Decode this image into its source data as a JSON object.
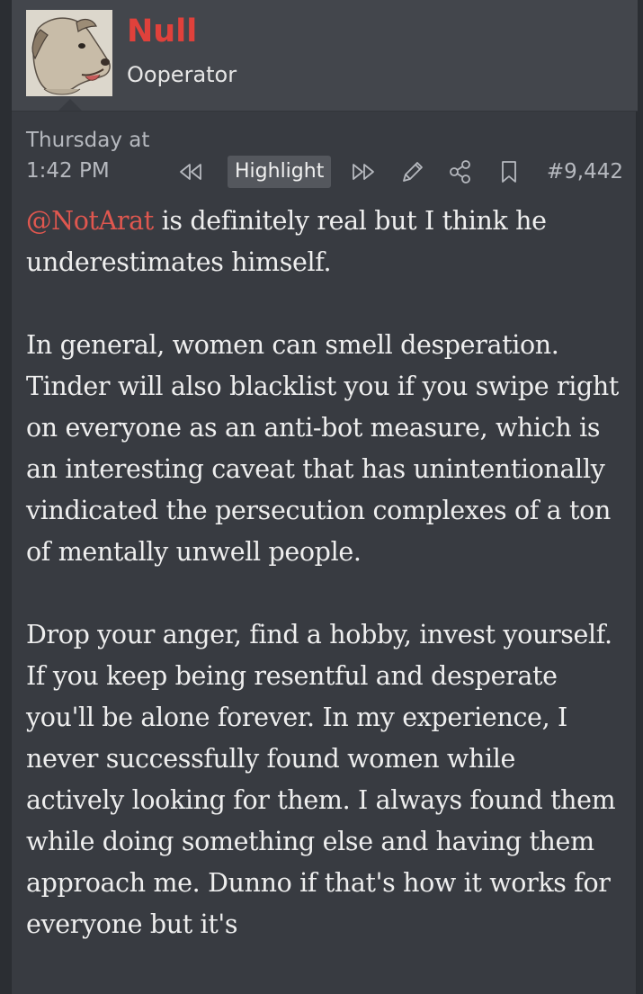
{
  "user": {
    "name": "Null",
    "title": "Ooperator",
    "name_color": "#e0413b",
    "avatar": "dog-avatar"
  },
  "post": {
    "date_line1": "Thursday at",
    "date_line2": "1:42 PM",
    "number": "#9,442",
    "actions": {
      "highlight_label": "Highlight",
      "icons": [
        "rewind-icon",
        "fast-forward-icon",
        "pencil-icon",
        "share-icon",
        "bookmark-icon"
      ]
    },
    "mention": "@NotArat",
    "paragraph1_rest": " is definitely real but I think he underestimates himself.",
    "paragraph2": "In general, women can smell desperation. Tinder will also blacklist you if you swipe right on everyone as an anti-bot measure, which is an interesting caveat that has unintentionally vindicated the persecution complexes of a ton of mentally unwell people.",
    "paragraph3": "Drop your anger, find a hobby, invest yourself. If you keep being resentful and desperate you'll be alone forever. In my experience, I never successfully found women while actively looking for them. I always found them while doing something else and having them approach me. Dunno if that's how it works for everyone but it's"
  }
}
